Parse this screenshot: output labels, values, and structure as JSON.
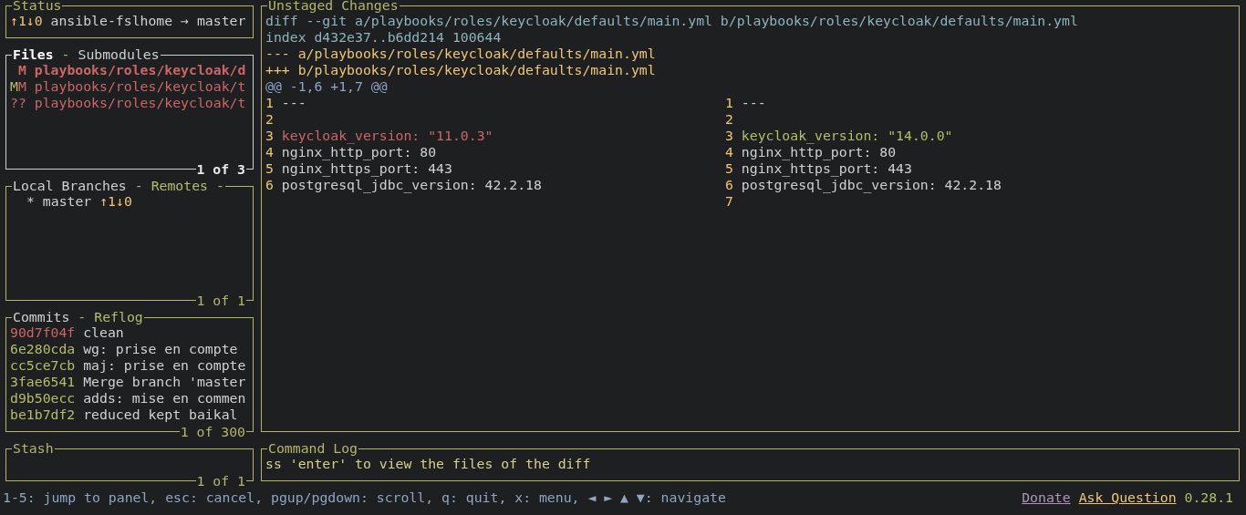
{
  "status": {
    "title": "Status",
    "focused": false,
    "ahead_behind": "↑1↓0",
    "repo": "ansible-fslhome",
    "arrow": "→",
    "branch": "master"
  },
  "files": {
    "focused": true,
    "tabs": [
      {
        "label": "Files",
        "selected": true
      },
      {
        "label": "Submodules",
        "selected": false
      }
    ],
    "tab_separator": "-",
    "counter": "1 of 3",
    "rows": [
      {
        "kind": "tracked",
        "code": " M",
        "path": "playbooks/roles/keycloak/d",
        "selected": true
      },
      {
        "kind": "tracked",
        "code": "MM",
        "path": "playbooks/roles/keycloak/t",
        "selected": false
      },
      {
        "kind": "untracked",
        "code": "??",
        "path": "playbooks/roles/keycloak/t",
        "selected": false
      }
    ]
  },
  "branches": {
    "focused": false,
    "tabs": [
      {
        "label": "Local Branches",
        "selected": true
      },
      {
        "label": "Remotes",
        "selected": false
      }
    ],
    "tab_separator": "-",
    "title_overflow": "-",
    "counter": "1 of 1",
    "rows": [
      {
        "marker": "*",
        "name": "master",
        "ahead_behind": "↑1↓0"
      }
    ]
  },
  "commits": {
    "focused": false,
    "tabs": [
      {
        "label": "Commits",
        "selected": true
      },
      {
        "label": "Reflog",
        "selected": false
      }
    ],
    "tab_separator": "-",
    "counter": "1 of 300",
    "rows": [
      {
        "hash": "90d7f04f",
        "message": "clean",
        "pushed": false
      },
      {
        "hash": "6e280cda",
        "message": "wg: prise en compte",
        "pushed": true
      },
      {
        "hash": "cc5ce7cb",
        "message": "maj: prise en compte",
        "pushed": true
      },
      {
        "hash": "3fae6541",
        "message": "Merge branch 'master",
        "pushed": true
      },
      {
        "hash": "d9b50ecc",
        "message": "adds: mise en commen",
        "pushed": true
      },
      {
        "hash": "be1b7df2",
        "message": "reduced kept baikal",
        "pushed": true
      }
    ]
  },
  "stash": {
    "focused": false,
    "title": "Stash",
    "counter": "1 of 1"
  },
  "unstaged": {
    "focused": false,
    "title": "Unstaged Changes",
    "header_lines": [
      {
        "kind": "meta",
        "text": "diff --git a/playbooks/roles/keycloak/defaults/main.yml b/playbooks/roles/keycloak/defaults/main.yml"
      },
      {
        "kind": "meta",
        "text": "index d432e37..b6dd214 100644"
      },
      {
        "kind": "file",
        "text": "--- a/playbooks/roles/keycloak/defaults/main.yml"
      },
      {
        "kind": "file",
        "text": "+++ b/playbooks/roles/keycloak/defaults/main.yml"
      },
      {
        "kind": "hunk",
        "text": "@@ -1,6 +1,7 @@"
      }
    ],
    "rows": [
      {
        "left": {
          "number": "1",
          "text": "---",
          "kind": "context"
        },
        "right": {
          "number": "1",
          "text": "---",
          "kind": "context"
        }
      },
      {
        "left": {
          "number": "2"
        },
        "right": {
          "number": "2"
        }
      },
      {
        "left": {
          "number": "3",
          "text": "keycloak_version: \"11.0.3\"",
          "kind": "removed"
        },
        "right": {
          "number": "3",
          "text": "keycloak_version: \"14.0.0\"",
          "kind": "added"
        }
      },
      {
        "left": {
          "number": "4",
          "text": "nginx_http_port: 80",
          "kind": "context"
        },
        "right": {
          "number": "4",
          "text": "nginx_http_port: 80",
          "kind": "context"
        }
      },
      {
        "left": {
          "number": "5",
          "text": "nginx_https_port: 443",
          "kind": "context"
        },
        "right": {
          "number": "5",
          "text": "nginx_https_port: 443",
          "kind": "context"
        }
      },
      {
        "left": {
          "number": "6",
          "text": "postgresql_jdbc_version: 42.2.18",
          "kind": "context"
        },
        "right": {
          "number": "6",
          "text": "postgresql_jdbc_version: 42.2.18",
          "kind": "context"
        }
      },
      {
        "right": {
          "number": "7"
        }
      }
    ]
  },
  "command_log": {
    "focused": false,
    "title": "Command Log",
    "lines": [
      "ss 'enter' to view the files of the diff"
    ]
  },
  "footer": {
    "keybindings": "1-5: jump to panel, esc: cancel, pgup/pgdown: scroll, q: quit, x: menu, ◄ ► ▲ ▼: navigate",
    "links": [
      {
        "label": "Donate",
        "kind": "donate"
      },
      {
        "label": "Ask Question",
        "kind": "ask"
      }
    ],
    "version": "0.28.1"
  }
}
